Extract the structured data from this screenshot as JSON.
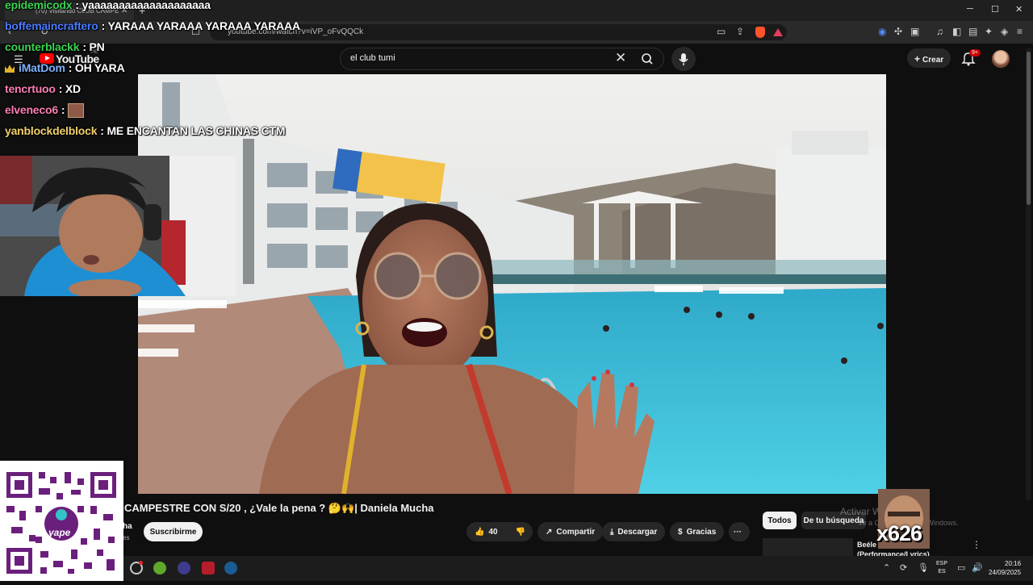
{
  "browser": {
    "tab_title": "(70) Visitando CLUB CAMPE",
    "url": "youtube.com/watch?v=iVP_oFvQQCk",
    "win_min": "─",
    "win_max": "☐",
    "win_close": "✕"
  },
  "youtube": {
    "logo_text": "YouTube",
    "logo_region": "PE",
    "search_query": "el club tumi",
    "create_label": "Crear",
    "notification_badge": "9+",
    "video_title": "CAMPESTRE CON S/20 , ¿Vale la pena ? 🤔🙌| Daniela Mucha",
    "channel_fragment": "ha",
    "subs_fragment": "es",
    "subscribe_label": "Suscribirme",
    "like_count": "40",
    "share_label": "Compartir",
    "download_label": "Descargar",
    "thanks_label": "Gracias",
    "more_label": "···",
    "filter_all": "Todos",
    "filter_search": "De tu búsqueda",
    "rec_title_line1": "Beéle",
    "rec_title_line2": "(Performance/Lyrics)"
  },
  "windows_watermark": {
    "line1": "Activar W",
    "line2": "Ve a Config... activar Windows."
  },
  "taskbar": {
    "lang_top": "ESP",
    "lang_bottom": "ES",
    "time": "20:16",
    "date": "24/09/2025"
  },
  "chat": [
    {
      "user": "epidemicodx",
      "color": "#39d353",
      "message": "yaaaaaaaaaaaaaaaaaaaa"
    },
    {
      "user": "boffemaincraftero",
      "color": "#4a7bff",
      "message": "YARAAA YARAAA YARAAA YARAAA"
    },
    {
      "user": "counterblackk",
      "color": "#39d353",
      "message": "PN"
    },
    {
      "user": "iMatDom",
      "color": "#7fb2ff",
      "message": "OH YARA"
    },
    {
      "user": "tencrtuoo",
      "color": "#ff7eb6",
      "message": "XD"
    },
    {
      "user": "elveneco6",
      "color": "#ff7eb6",
      "message": ""
    },
    {
      "user": "yanblockdelblock",
      "color": "#f2d16b",
      "message": "ME ENCANTAN LAS CHINAS CTM"
    }
  ],
  "overlays": {
    "qr_label": "yape",
    "combo_counter": "x626"
  },
  "colors": {
    "youtube_red": "#ff0000",
    "page_bg": "#0f0f0f",
    "pill_bg": "#272727",
    "pool_blue": "#3cc2d9",
    "sky": "#e6e6e3"
  }
}
